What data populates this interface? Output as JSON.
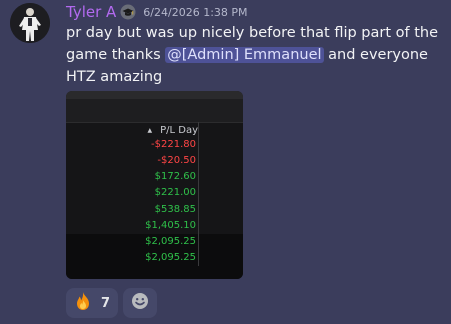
{
  "message": {
    "author": "Tyler A",
    "timestamp": "6/24/2026 1:38 PM",
    "text_before_mention": "pr day but was up nicely before that flip part of the game thanks ",
    "mention": "@[Admin] Emmanuel",
    "text_after_mention": " and everyone HTZ amazing",
    "role_icon": "graduation-cap-icon",
    "colors": {
      "background": "#3b3d5c",
      "username": "#b36af0",
      "mention_bg": "#4e5297"
    }
  },
  "attachment": {
    "column_header": "P/L Day",
    "sort_icon": "sort-up-icon",
    "rows": [
      {
        "value": "-$221.80",
        "sign": "neg"
      },
      {
        "value": "-$20.50",
        "sign": "neg"
      },
      {
        "value": "$172.60",
        "sign": "pos"
      },
      {
        "value": "$221.00",
        "sign": "pos"
      },
      {
        "value": "$538.85",
        "sign": "pos"
      },
      {
        "value": "$1,405.10",
        "sign": "pos"
      },
      {
        "value": "$2,095.25",
        "sign": "pos"
      },
      {
        "value": "$2,095.25",
        "sign": "pos"
      }
    ],
    "colors": {
      "negative": "#ff4545",
      "positive": "#2fc04a"
    }
  },
  "reactions": [
    {
      "emoji_icon": "fire-icon",
      "count": "7"
    },
    {
      "emoji_icon": "add-reaction-icon",
      "count": ""
    }
  ]
}
